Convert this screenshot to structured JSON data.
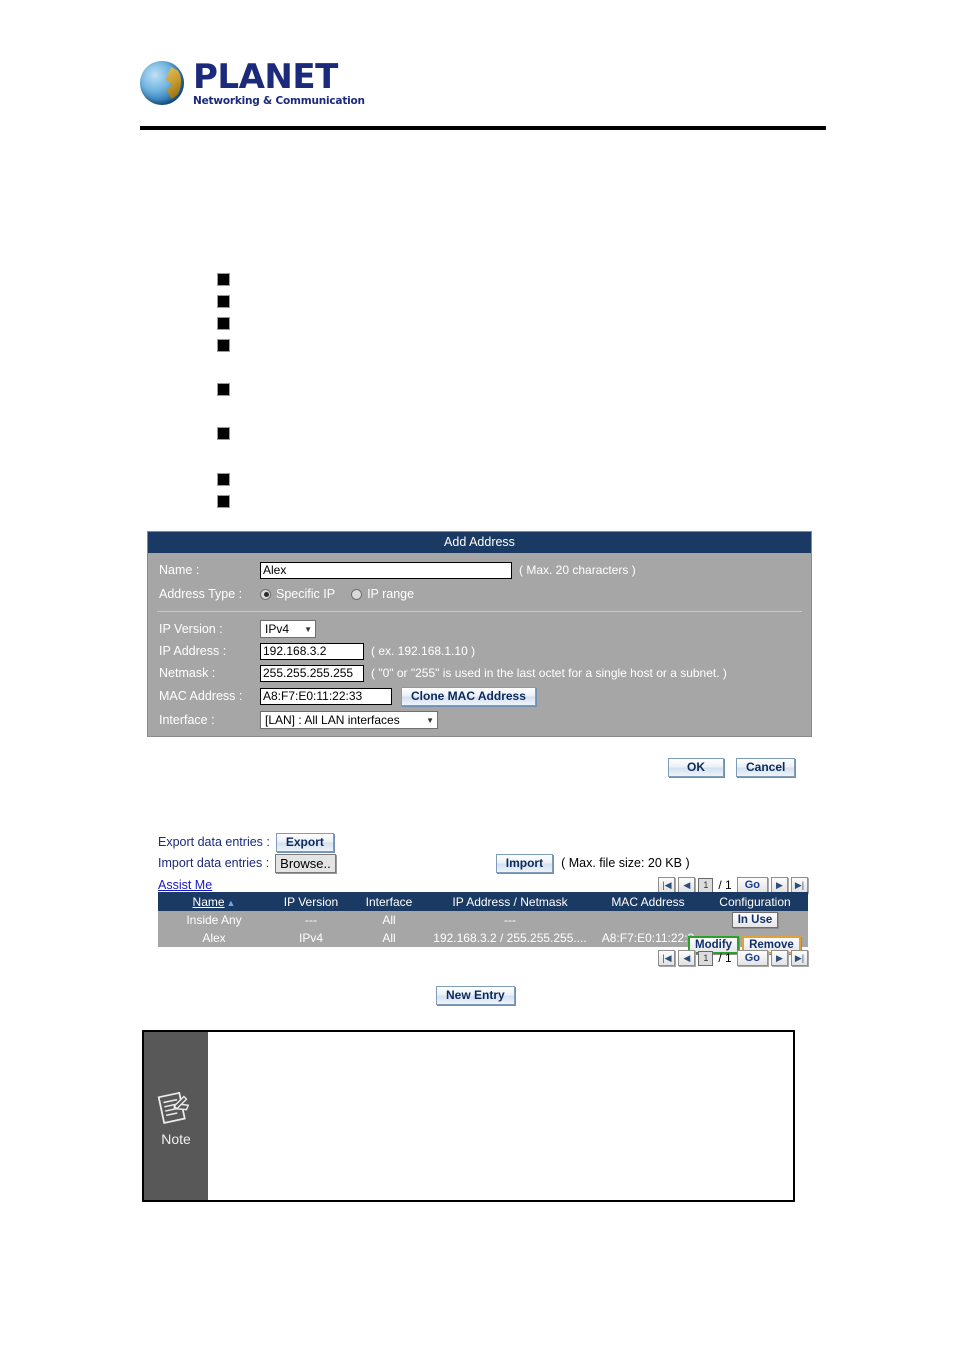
{
  "header": {
    "logo_word": "PLANET",
    "logo_tagline": "Networking & Communication"
  },
  "bullets": [
    {
      "marker": "square-bullet",
      "text": ""
    },
    {
      "marker": "square-bullet",
      "text": ""
    },
    {
      "marker": "square-bullet",
      "text": ""
    },
    {
      "marker": "square-bullet",
      "text": ""
    },
    {
      "marker": "square-bullet",
      "text": ""
    },
    {
      "marker": "square-bullet",
      "text": ""
    },
    {
      "marker": "square-bullet",
      "text": ""
    },
    {
      "marker": "square-bullet",
      "text": ""
    },
    {
      "marker": "square-bullet",
      "text": ""
    }
  ],
  "dialog": {
    "title": "Add Address",
    "name_label": "Name :",
    "name_value": "Alex",
    "name_hint": "( Max. 20 characters )",
    "address_type_label": "Address Type :",
    "radio_specific_ip": "Specific IP",
    "radio_ip_range": "IP range",
    "ip_version_label": "IP Version :",
    "ip_version_value": "IPv4",
    "ip_address_label": "IP Address :",
    "ip_address_value": "192.168.3.2",
    "ip_address_hint": "( ex. 192.168.1.10 )",
    "netmask_label": "Netmask :",
    "netmask_value": "255.255.255.255",
    "netmask_hint": "( \"0\" or \"255\" is used in the last octet for a single host or a subnet. )",
    "mac_label": "MAC Address :",
    "mac_value": "A8:F7:E0:11:22:33",
    "clone_mac_button": "Clone MAC Address",
    "interface_label": "Interface :",
    "interface_value": "[LAN] : All LAN interfaces",
    "ok_button": "OK",
    "cancel_button": "Cancel"
  },
  "io": {
    "export_label": "Export data entries :",
    "export_button": "Export",
    "import_label": "Import data entries :",
    "browse_button": "Browse..",
    "import_button": "Import",
    "import_hint": "( Max. file size: 20 KB )",
    "assist_link": "Assist Me"
  },
  "pager": {
    "first": "|◀",
    "prev": "◀",
    "page_value": "1",
    "total": "/ 1",
    "go": "Go",
    "next": "▶",
    "last": "▶|"
  },
  "table": {
    "columns": [
      "Name",
      "IP Version",
      "Interface",
      "IP Address / Netmask",
      "MAC Address",
      "Configuration"
    ],
    "sort_indicator": "▲",
    "rows": [
      {
        "name": "Inside Any",
        "ip_version": "---",
        "interface": "All",
        "ip_netmask": "---",
        "mac": "",
        "actions": [
          "In Use"
        ]
      },
      {
        "name": "Alex",
        "ip_version": "IPv4",
        "interface": "All",
        "ip_netmask": "192.168.3.2 / 255.255.255....",
        "mac": "A8:F7:E0:11:22:3",
        "actions": [
          "Modify",
          "Remove"
        ]
      }
    ]
  },
  "new_entry_button": "New Entry",
  "note": {
    "label": "Note",
    "icon": "note-pencil-icon",
    "text": ""
  },
  "colors": {
    "header_blue": "#1b3a63",
    "panel_gray": "#a6a6a6",
    "link_blue": "#1818c8",
    "modify_green": "#2ca02c",
    "remove_orange": "#e0a13a",
    "note_gray": "#585858"
  }
}
